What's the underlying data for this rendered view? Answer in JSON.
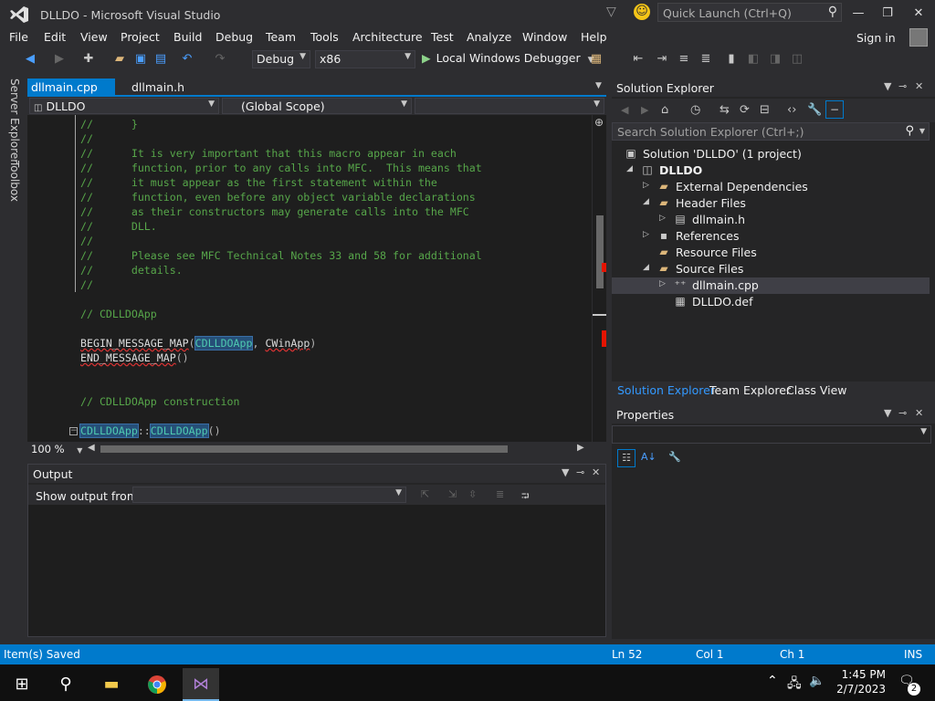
{
  "window": {
    "title": "DLLDO - Microsoft Visual Studio",
    "quick_launch_placeholder": "Quick Launch (Ctrl+Q)"
  },
  "menu": [
    "File",
    "Edit",
    "View",
    "Project",
    "Build",
    "Debug",
    "Team",
    "Tools",
    "Architecture",
    "Test",
    "Analyze",
    "Window",
    "Help"
  ],
  "account": {
    "sign_in": "Sign in"
  },
  "toolbar": {
    "configuration": "Debug",
    "platform": "x86",
    "debugger": "Local Windows Debugger"
  },
  "left_tabs": [
    "Server Explorer",
    "Toolbox"
  ],
  "editor": {
    "tabs": [
      {
        "label": "dllmain.cpp",
        "active": true
      },
      {
        "label": "dllmain.h",
        "active": false
      }
    ],
    "nav": {
      "project": "DLLDO",
      "scope": "(Global Scope)",
      "member": ""
    },
    "zoom": "100 %",
    "lines": [
      "//      }",
      "//",
      "//      It is very important that this macro appear in each",
      "//      function, prior to any calls into MFC.  This means that",
      "//      it must appear as the first statement within the",
      "//      function, even before any object variable declarations",
      "//      as their constructors may generate calls into the MFC",
      "//      DLL.",
      "//",
      "//      Please see MFC Technical Notes 33 and 58 for additional",
      "//      details.",
      "//",
      "",
      "// CDLLDOApp",
      "",
      "BEGIN_MESSAGE_MAP|CDLLDOApp|CWinApp",
      "END_MESSAGE_MAP",
      "",
      "",
      "// CDLLDOApp construction",
      "",
      "CDLLDOApp::CDLLDOApp()"
    ]
  },
  "output": {
    "title": "Output",
    "show_from_label": "Show output from:",
    "show_from_value": ""
  },
  "solution_explorer": {
    "title": "Solution Explorer",
    "search_placeholder": "Search Solution Explorer (Ctrl+;)",
    "tree": [
      {
        "label": "Solution 'DLLDO' (1 project)",
        "indent": 0,
        "arrow": "",
        "icon": "solution-icon",
        "bold": false
      },
      {
        "label": "DLLDO",
        "indent": 1,
        "arrow": "expanded",
        "icon": "project-icon",
        "bold": true
      },
      {
        "label": "External Dependencies",
        "indent": 2,
        "arrow": "collapsed",
        "icon": "folder-icon",
        "bold": false
      },
      {
        "label": "Header Files",
        "indent": 2,
        "arrow": "expanded",
        "icon": "folder-icon",
        "bold": false
      },
      {
        "label": "dllmain.h",
        "indent": 3,
        "arrow": "collapsed",
        "icon": "header-file-icon",
        "bold": false
      },
      {
        "label": "References",
        "indent": 2,
        "arrow": "collapsed",
        "icon": "references-icon",
        "bold": false
      },
      {
        "label": "Resource Files",
        "indent": 2,
        "arrow": "",
        "icon": "folder-icon",
        "bold": false
      },
      {
        "label": "Source Files",
        "indent": 2,
        "arrow": "expanded",
        "icon": "folder-icon",
        "bold": false
      },
      {
        "label": "dllmain.cpp",
        "indent": 3,
        "arrow": "collapsed",
        "icon": "cpp-file-icon",
        "bold": false,
        "selected": true
      },
      {
        "label": "DLLDO.def",
        "indent": 3,
        "arrow": "",
        "icon": "def-file-icon",
        "bold": false
      }
    ],
    "bottom_tabs": [
      "Solution Explorer",
      "Team Explorer",
      "Class View"
    ]
  },
  "properties": {
    "title": "Properties"
  },
  "status": {
    "message": "Item(s) Saved",
    "line": "Ln 52",
    "col": "Col 1",
    "ch": "Ch 1",
    "mode": "INS"
  },
  "taskbar": {
    "time": "1:45 PM",
    "date": "2/7/2023",
    "notifications": "2"
  },
  "colors": {
    "accent": "#007acc",
    "comment": "#57a64a",
    "class_name": "#4ec9b0",
    "editor_bg": "#1e1e1e"
  }
}
